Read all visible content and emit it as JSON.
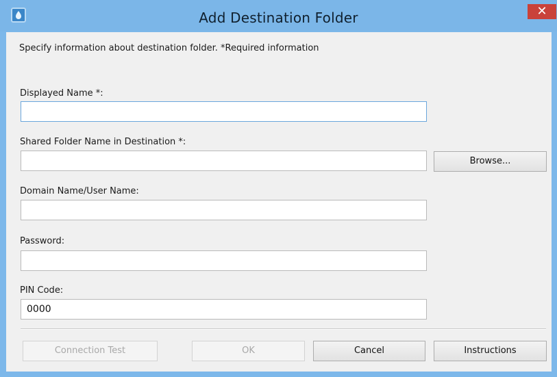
{
  "window": {
    "title": "Add Destination Folder",
    "close_glyph": "✕",
    "app_icon": "printer-app-icon",
    "colors": {
      "frame": "#7bb6e8",
      "close": "#c9423a",
      "client": "#f0f0f0"
    }
  },
  "form": {
    "instruction": "Specify information about destination folder.  *Required information",
    "fields": {
      "displayed_name": {
        "label": "Displayed Name *:",
        "value": ""
      },
      "shared_folder": {
        "label": "Shared Folder Name in Destination *:",
        "value": ""
      },
      "domain_user": {
        "label": "Domain Name/User Name:",
        "value": ""
      },
      "password": {
        "label": "Password:",
        "value": ""
      },
      "pin_code": {
        "label": "PIN Code:",
        "value": "0000"
      }
    },
    "browse_label": "Browse..."
  },
  "footer": {
    "connection_test_label": "Connection Test",
    "ok_label": "OK",
    "cancel_label": "Cancel",
    "instructions_label": "Instructions"
  }
}
